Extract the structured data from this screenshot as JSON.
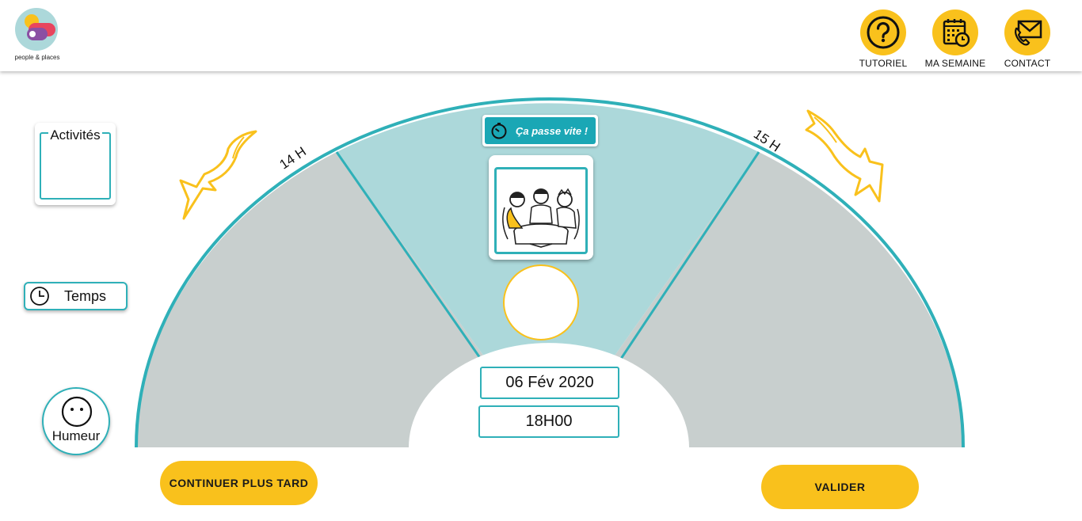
{
  "header": {
    "logo_text": "people & places",
    "nav": [
      {
        "label": "TUTORIEL",
        "icon": "help-icon"
      },
      {
        "label": "MA SEMAINE",
        "icon": "calendar-clock-icon"
      },
      {
        "label": "CONTACT",
        "icon": "envelope-phone-icon"
      }
    ]
  },
  "side": {
    "activities_label": "Activités",
    "time_label": "Temps",
    "mood_label": "Humeur"
  },
  "wheel": {
    "hour_left": "14 H",
    "hour_right": "15 H",
    "badge_text": "Ça passe vite !",
    "date": "06 Fév 2020",
    "time": "18H00"
  },
  "buttons": {
    "later": "CONTINUER PLUS TARD",
    "validate": "VALIDER"
  },
  "colors": {
    "accent": "#f9c11c",
    "teal": "#2fb0b8",
    "teal_light": "#acd8da",
    "grey": "#c8cfce"
  }
}
